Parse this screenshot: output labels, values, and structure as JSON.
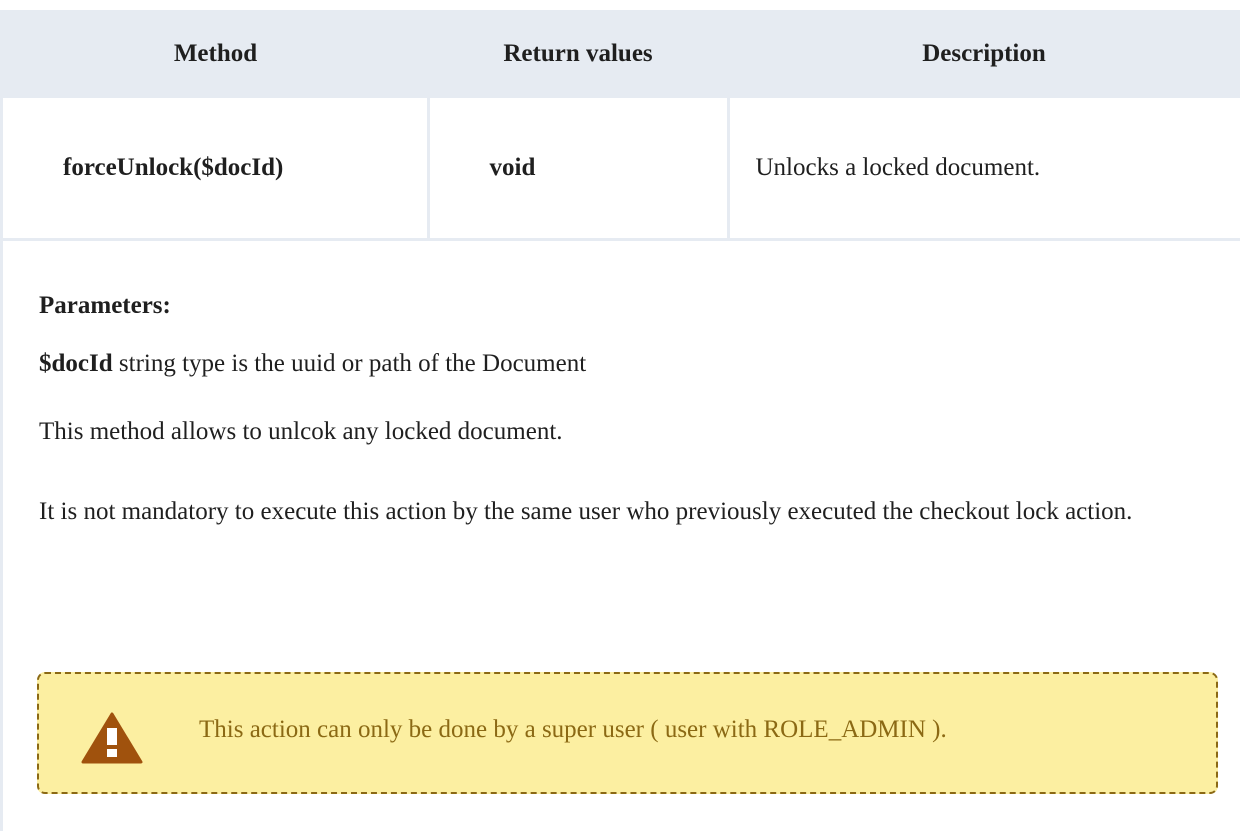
{
  "table": {
    "headers": [
      "Method",
      "Return values",
      "Description"
    ],
    "row": {
      "method": "forceUnlock($docId)",
      "return_value": "void",
      "description": "Unlocks a locked document."
    }
  },
  "content": {
    "parameters_title": "Parameters:",
    "param_name": "$docId",
    "param_desc": "string type is the uuid or path of the Document",
    "paragraph1": "This method allows to unlcok any locked document.",
    "paragraph2": "It is not mandatory to execute this action by the same user who previously executed the checkout lock action."
  },
  "warning": {
    "icon": "warning-triangle-icon",
    "text": "This action can only be done by a super user ( user with ROLE_ADMIN ).",
    "background": "#fcefa1",
    "text_color": "#8b6914",
    "icon_color": "#a0520d"
  }
}
